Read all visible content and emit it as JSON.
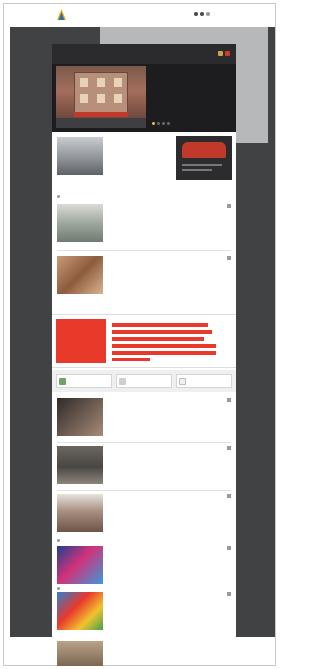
{
  "header": {
    "logo_text": "",
    "login_label": "",
    "nav": []
  },
  "dark_nav": {
    "items": []
  },
  "hero": {
    "kicker": "",
    "title": ""
  },
  "articles": [
    {
      "kicker": "",
      "title": "",
      "meta": ""
    },
    {
      "kicker": "",
      "title": "",
      "meta": ""
    },
    {
      "kicker": "",
      "title": "",
      "meta": ""
    },
    {
      "kicker": "",
      "title": "",
      "meta": ""
    },
    {
      "kicker": "",
      "title": "",
      "meta": ""
    },
    {
      "kicker": "",
      "title": "",
      "meta": ""
    },
    {
      "kicker": "",
      "title": "",
      "meta": ""
    },
    {
      "kicker": "",
      "title": "",
      "meta": ""
    },
    {
      "kicker": "",
      "title": "",
      "meta": ""
    }
  ],
  "sections": [
    "",
    "",
    "",
    ""
  ],
  "widgets": [
    "",
    "",
    ""
  ],
  "colors": {
    "accent": "#e8392b",
    "background": "#414244",
    "nav_dark": "#2b2b2d"
  }
}
